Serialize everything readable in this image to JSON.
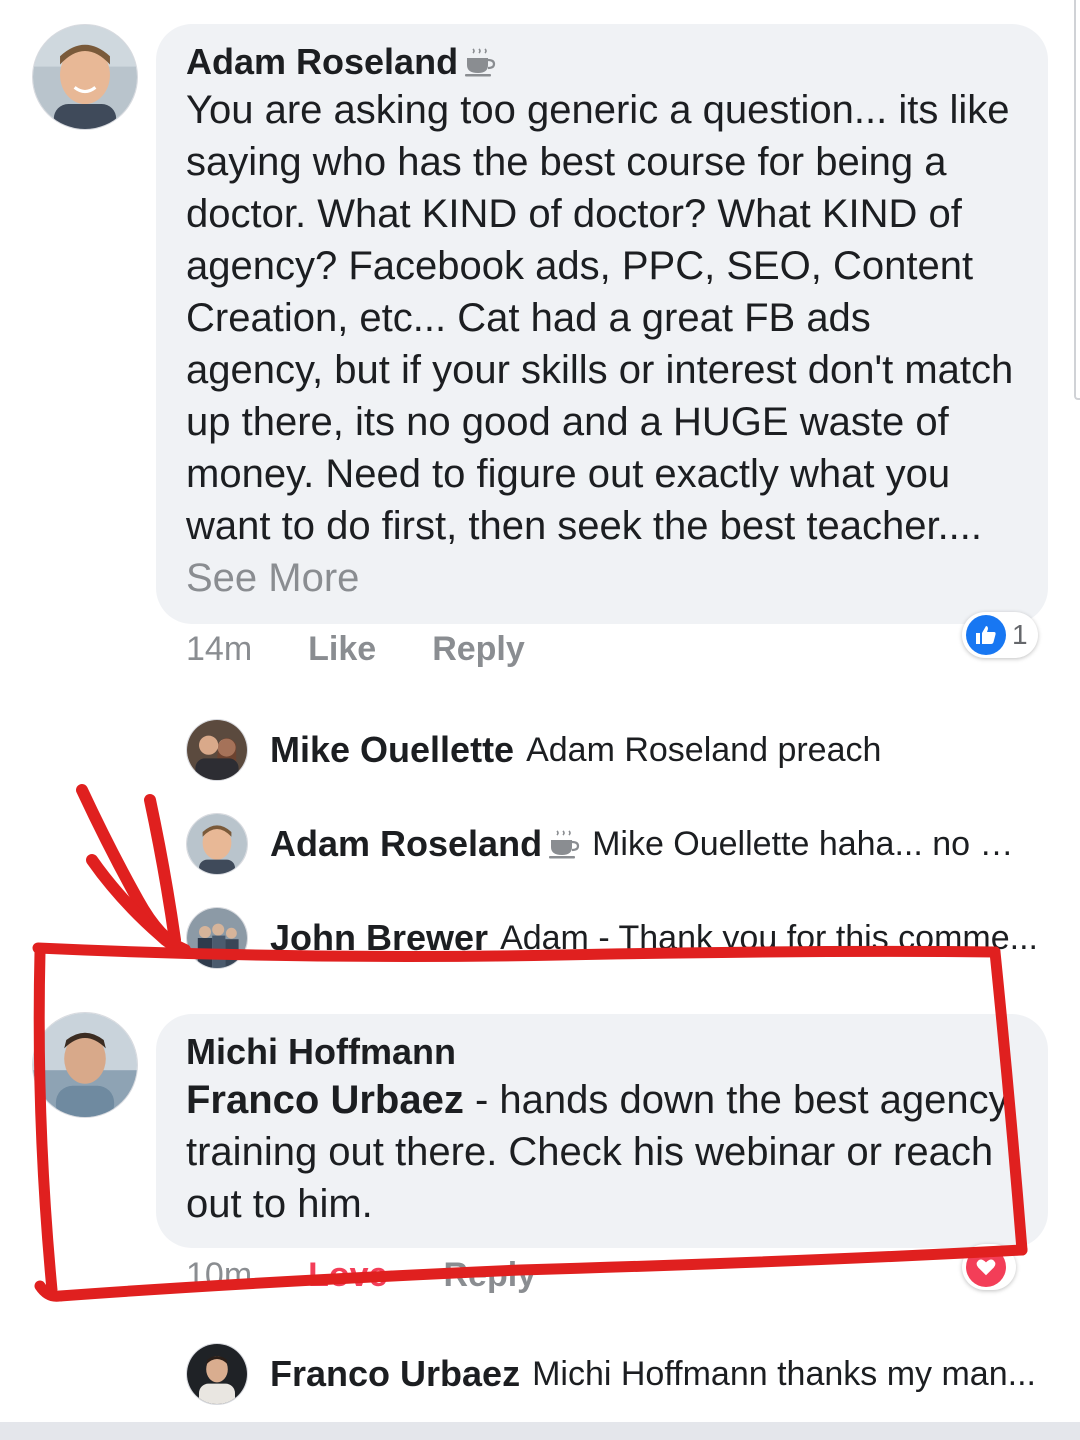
{
  "comments": [
    {
      "author": "Adam Roseland",
      "text": "You are asking too generic a question... its like saying who has the best course for being a doctor.  What KIND of doctor?  What KIND of agency?  Facebook ads, PPC, SEO, Content Creation, etc... Cat had a great FB ads agency, but if your skills or interest don't match up there, its no good and a HUGE waste of money.  Need to figure out exactly what you want to do first, then seek the best teacher....",
      "see_more": "See More",
      "time": "14m",
      "like_label": "Like",
      "reply_label": "Reply",
      "reaction_count": "1"
    },
    {
      "author": "Michi Hoffmann",
      "mention": "Franco Urbaez",
      "text": " - hands down the best agency training out there. Check his webinar or reach out to him.",
      "time": "10m",
      "love_label": "Love",
      "reply_label": "Reply"
    }
  ],
  "replies": [
    {
      "author": "Mike Ouellette",
      "text": "Adam Roseland preach"
    },
    {
      "author": "Adam Roseland",
      "text": "Mike Ouellette haha... no ma..."
    },
    {
      "author": "John Brewer",
      "text": "Adam - Thank you for this comme..."
    },
    {
      "author": "Franco Urbaez",
      "text": "Michi Hoffmann thanks my man..."
    }
  ],
  "colors": {
    "bubble": "#f0f2f5",
    "meta_text": "#8a8d91",
    "like_blue": "#1877f2",
    "love_red": "#f33e58",
    "annotation_red": "#e0201f"
  },
  "icons": [
    "coffee-icon",
    "like-thumb-icon",
    "love-heart-icon"
  ]
}
